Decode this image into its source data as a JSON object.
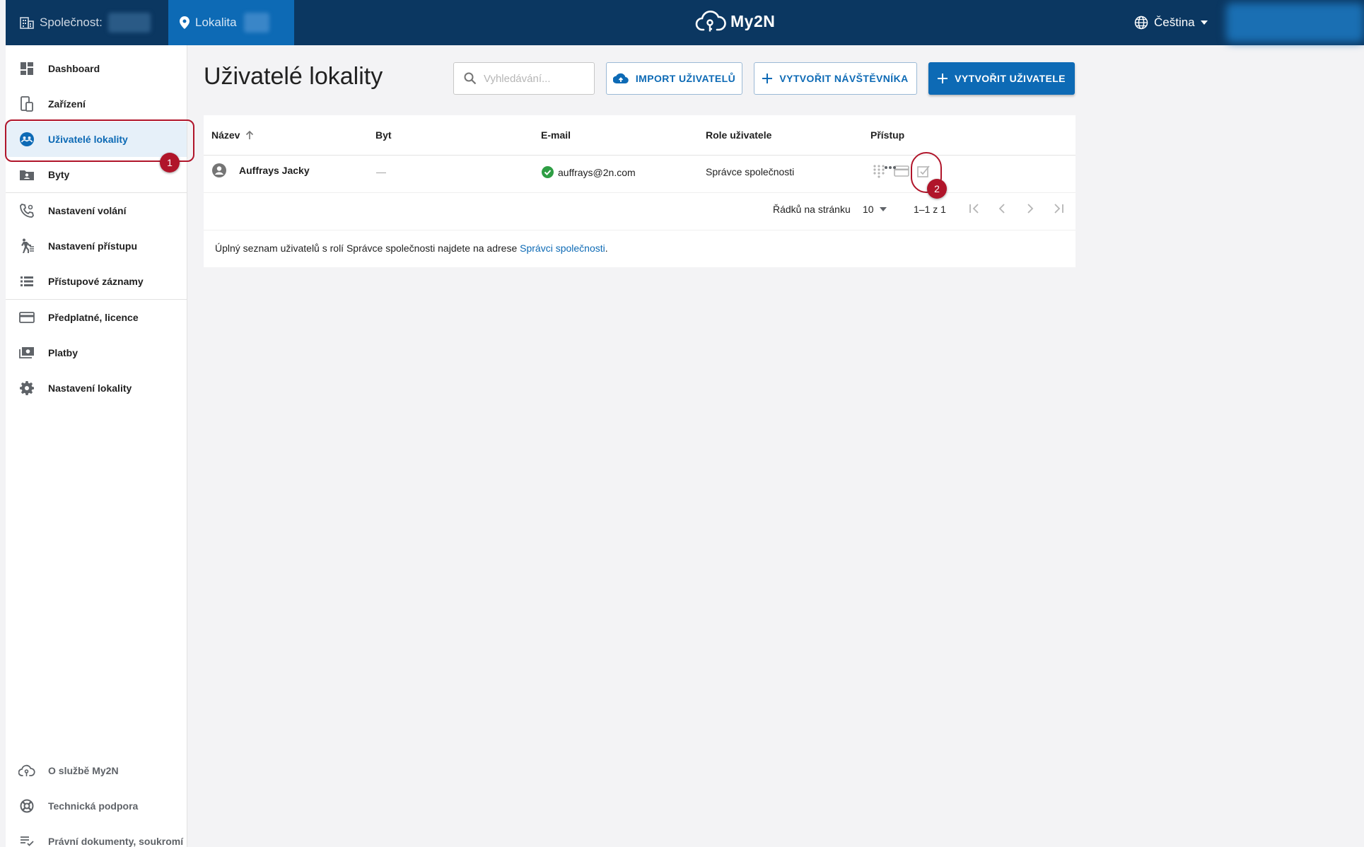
{
  "topbar": {
    "company_label": "Společnost:",
    "site_label": "Lokalita",
    "logo": "My2N",
    "language": "Čeština",
    "icons": {
      "company": "building-icon",
      "site": "location-pin-icon",
      "logo": "cloud-key-icon",
      "language": "globe-icon"
    }
  },
  "sidebar": {
    "items": [
      {
        "label": "Dashboard",
        "icon": "dashboard-icon"
      },
      {
        "label": "Zařízení",
        "icon": "devices-icon"
      },
      {
        "label": "Uživatelé lokality",
        "icon": "users-icon",
        "active": true
      },
      {
        "label": "Byty",
        "icon": "apartments-icon"
      },
      {
        "label": "Nastavení volání",
        "icon": "phone-settings-icon"
      },
      {
        "label": "Nastavení přístupu",
        "icon": "walking-person-icon"
      },
      {
        "label": "Přístupové záznamy",
        "icon": "list-icon"
      },
      {
        "label": "Předplatné, licence",
        "icon": "credit-card-icon"
      },
      {
        "label": "Platby",
        "icon": "payments-icon"
      },
      {
        "label": "Nastavení lokality",
        "icon": "gear-icon"
      }
    ],
    "footer": [
      {
        "label": "O službě My2N",
        "icon": "cloud-icon"
      },
      {
        "label": "Technická podpora",
        "icon": "lifebuoy-icon"
      },
      {
        "label": "Právní dokumenty, soukromí",
        "icon": "checklist-icon"
      }
    ]
  },
  "main": {
    "title": "Uživatelé lokality",
    "search_placeholder": "Vyhledávání...",
    "buttons": {
      "import": "IMPORT UŽIVATELŮ",
      "create_visitor": "VYTVOŘIT NÁVŠTĚVNÍKA",
      "create_user": "VYTVOŘIT UŽIVATELE"
    },
    "table": {
      "columns": [
        "Název",
        "Byt",
        "E-mail",
        "Role uživatele",
        "Přístup"
      ],
      "rows": [
        {
          "name": "Auffrays Jacky",
          "apartment": "—",
          "email": "auffrays@2n.com",
          "role": "Správce společnosti",
          "access_icons": [
            "pin-keypad-icon",
            "card-icon",
            "access-edit-icon"
          ]
        }
      ],
      "pagination": {
        "rows_per_page_label": "Řádků na stránku",
        "rows_per_page": "10",
        "range": "1–1 z 1"
      }
    },
    "note": {
      "text": "Úplný seznam uživatelů s rolí Správce společnosti najdete na adrese ",
      "link": "Správci společnosti",
      "end": "."
    }
  },
  "callouts": [
    "1",
    "2"
  ],
  "colors": {
    "topbar": "#0b3761",
    "accent": "#0d6ab5",
    "callout": "#b0152a",
    "success": "#2e9e44"
  }
}
